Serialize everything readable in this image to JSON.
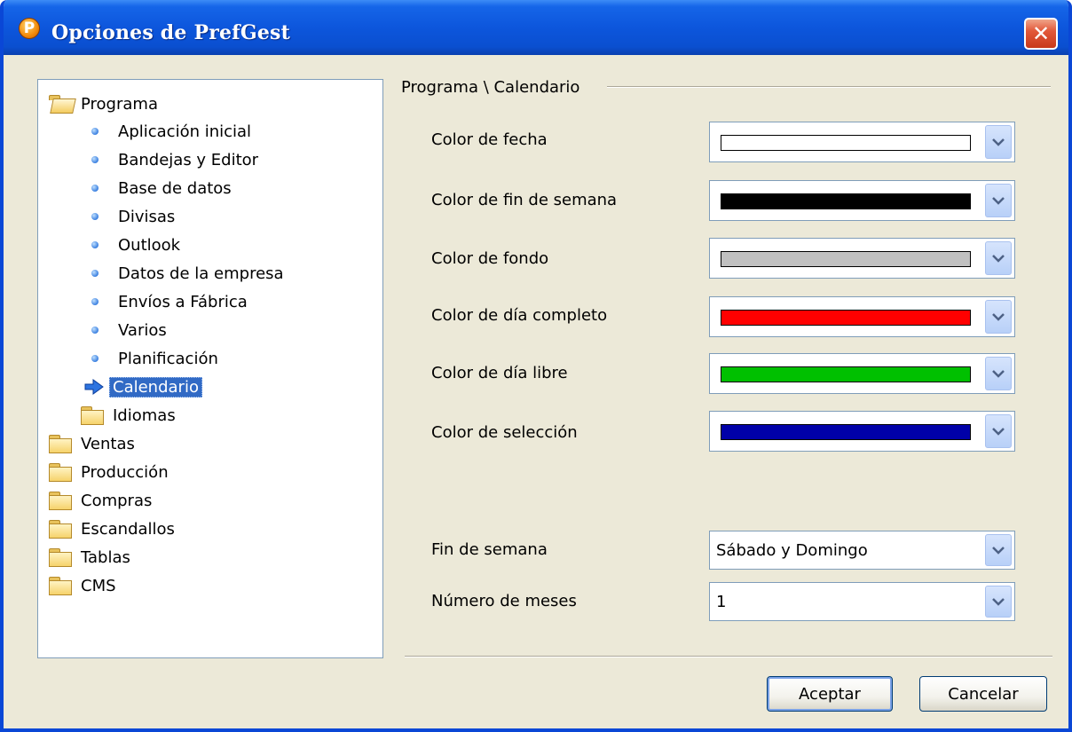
{
  "window": {
    "title": "Opciones de PrefGest",
    "icon": "prefgest-logo-icon",
    "icon_letter": "P",
    "close_glyph": "✕"
  },
  "tree": {
    "root": {
      "label": "Programa",
      "children": [
        {
          "label": "Aplicación inicial"
        },
        {
          "label": "Bandejas y Editor"
        },
        {
          "label": "Base de datos"
        },
        {
          "label": "Divisas"
        },
        {
          "label": "Outlook"
        },
        {
          "label": "Datos de la empresa"
        },
        {
          "label": "Envíos a Fábrica"
        },
        {
          "label": "Varios"
        },
        {
          "label": "Planificación"
        },
        {
          "label": "Calendario",
          "selected": true
        },
        {
          "label": "Idiomas",
          "folder": true
        }
      ]
    },
    "others": [
      {
        "label": "Ventas"
      },
      {
        "label": "Producción"
      },
      {
        "label": "Compras"
      },
      {
        "label": "Escandallos"
      },
      {
        "label": "Tablas"
      },
      {
        "label": "CMS"
      }
    ]
  },
  "panel": {
    "title": "Programa \\ Calendario",
    "colors": [
      {
        "label": "Color de fecha",
        "value": "#ffffff"
      },
      {
        "label": "Color de fin de semana",
        "value": "#000000"
      },
      {
        "label": "Color de fondo",
        "value": "#c0c0c0"
      },
      {
        "label": "Color de día completo",
        "value": "#ff0000"
      },
      {
        "label": "Color de día libre",
        "value": "#00c000"
      },
      {
        "label": "Color de selección",
        "value": "#0000a8"
      }
    ],
    "weekend": {
      "label": "Fin de semana",
      "value": "Sábado y Domingo"
    },
    "months": {
      "label": "Número de meses",
      "value": "1"
    }
  },
  "buttons": {
    "ok": "Aceptar",
    "cancel": "Cancelar"
  }
}
